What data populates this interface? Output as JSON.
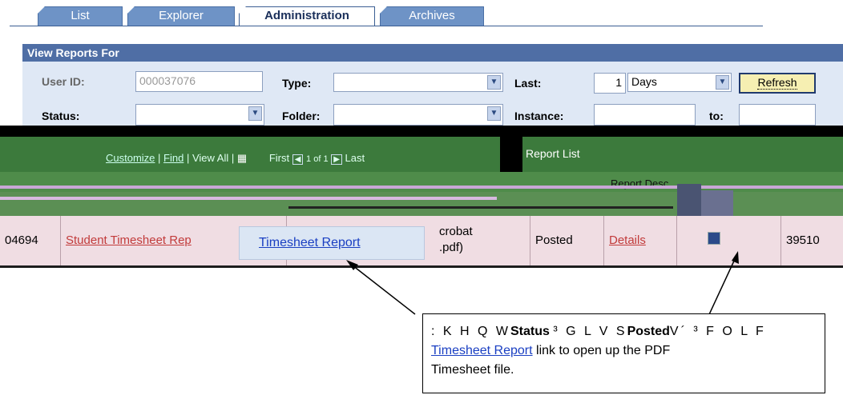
{
  "tabs": [
    {
      "label": "List"
    },
    {
      "label": "Explorer"
    },
    {
      "label": "Administration"
    },
    {
      "label": "Archives"
    }
  ],
  "panel": {
    "title": "View Reports For",
    "user_id_label": "User ID:",
    "user_id_value": "000037076",
    "type_label": "Type:",
    "type_value": "",
    "last_label": "Last:",
    "last_value": "1",
    "last_unit": "Days",
    "refresh_label": "Refresh",
    "status_label": "Status:",
    "folder_label": "Folder:",
    "instance_label": "Instance:",
    "to_label": "to:"
  },
  "grid": {
    "customize": "Customize",
    "find": "Find",
    "view_all": "View All",
    "first": "First",
    "range": "1 of 1",
    "last": "Last",
    "report_list": "Report List",
    "column_report_desc": "Report Desc"
  },
  "row": {
    "id": "04694",
    "description": "Student Timesheet Rep",
    "format": "crobat\n.pdf)",
    "status": "Posted",
    "details": "Details",
    "instance": "39510"
  },
  "tooltip": {
    "link": "Timesheet Report"
  },
  "callout": {
    "garbled": ": K H Q  W",
    "status_text": "Status",
    "garbled2": "³  G L V S",
    "posted_text": "Posted",
    "garbled3": "V´  ³ F O L F",
    "link": "Timesheet Report",
    "rest1": " link to open up the PDF",
    "rest2": "Timesheet file."
  },
  "colors": {
    "tab_blue": "#6e93c6",
    "panel_header": "#4f6ea5",
    "grid_green": "#3c7a3c",
    "row_pink": "#f0dde3",
    "link_red": "#c23b3b",
    "link_blue": "#1a3fc2"
  }
}
